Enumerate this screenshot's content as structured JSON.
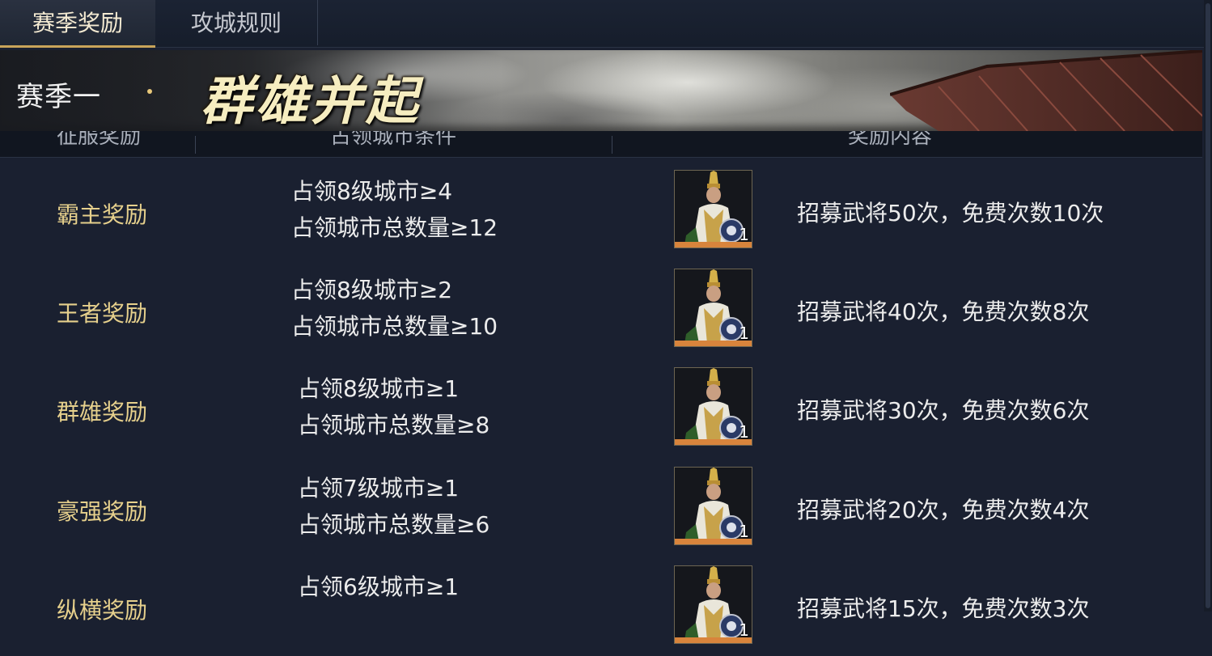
{
  "tabs": [
    {
      "label": "赛季奖励",
      "active": true
    },
    {
      "label": "攻城规则",
      "active": false
    }
  ],
  "banner": {
    "season": "赛季一",
    "title": "群雄并起"
  },
  "table": {
    "headers": [
      "征服奖励",
      "占领城市条件",
      "奖励内容"
    ],
    "rows": [
      {
        "name": "霸主奖励",
        "cond1": "占领8级城市≥4",
        "cond2": "占领城市总数量≥12",
        "item_count": "1",
        "reward": "招募武将50次，免费次数10次"
      },
      {
        "name": "王者奖励",
        "cond1": "占领8级城市≥2",
        "cond2": "占领城市总数量≥10",
        "item_count": "1",
        "reward": "招募武将40次，免费次数8次"
      },
      {
        "name": "群雄奖励",
        "cond1": "占领8级城市≥1",
        "cond2": "占领城市总数量≥8",
        "item_count": "1",
        "reward": "招募武将30次，免费次数6次"
      },
      {
        "name": "豪强奖励",
        "cond1": "占领7级城市≥1",
        "cond2": "占领城市总数量≥6",
        "item_count": "1",
        "reward": "招募武将20次，免费次数4次"
      },
      {
        "name": "纵横奖励",
        "cond1": "占领6级城市≥1",
        "cond2": "",
        "item_count": "1",
        "reward": "招募武将15次，免费次数3次"
      }
    ]
  },
  "colors": {
    "accent_gold": "#c8a45a",
    "row_name": "#e6d08c",
    "icon_bar": "#d8843c"
  }
}
